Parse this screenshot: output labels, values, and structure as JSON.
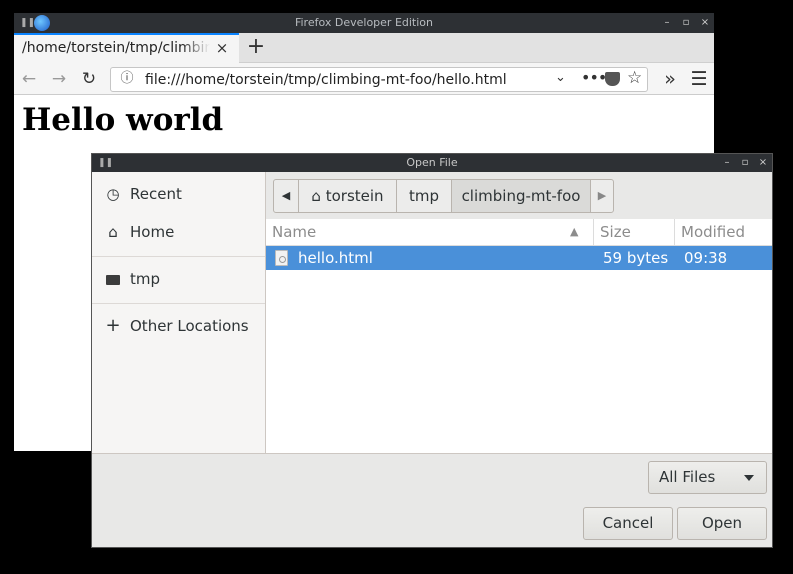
{
  "firefox": {
    "window_title": "Firefox Developer Edition",
    "tab_title": "/home/torstein/tmp/climbing-mt-foo/hello.html",
    "close_tab_glyph": "×",
    "new_tab_glyph": "+",
    "url": "file:///home/torstein/tmp/climbing-mt-foo/hello.html",
    "page_heading": "Hello world",
    "window_buttons": [
      "–",
      "▫",
      "×"
    ]
  },
  "dialog": {
    "title": "Open File",
    "window_buttons": [
      "–",
      "▫",
      "×"
    ],
    "sidebar": {
      "items": [
        {
          "label": "Recent",
          "icon": "clock-icon"
        },
        {
          "label": "Home",
          "icon": "home-icon"
        },
        {
          "label": "tmp",
          "icon": "folder-icon"
        },
        {
          "label": "Other Locations",
          "icon": "plus-icon"
        }
      ]
    },
    "path_bar": {
      "segments": [
        "torstein",
        "tmp",
        "climbing-mt-foo"
      ],
      "active_segment": "climbing-mt-foo"
    },
    "columns": {
      "name": "Name",
      "size": "Size",
      "modified": "Modified"
    },
    "files": [
      {
        "name": "hello.html",
        "size": "59 bytes",
        "modified": "09:38",
        "selected": true
      }
    ],
    "filter": "All Files",
    "cancel_label": "Cancel",
    "open_label": "Open"
  },
  "colors": {
    "selection": "#4a90d9",
    "titlebar": "#2d3034",
    "firefox_tab_accent": "#0a84ff"
  }
}
